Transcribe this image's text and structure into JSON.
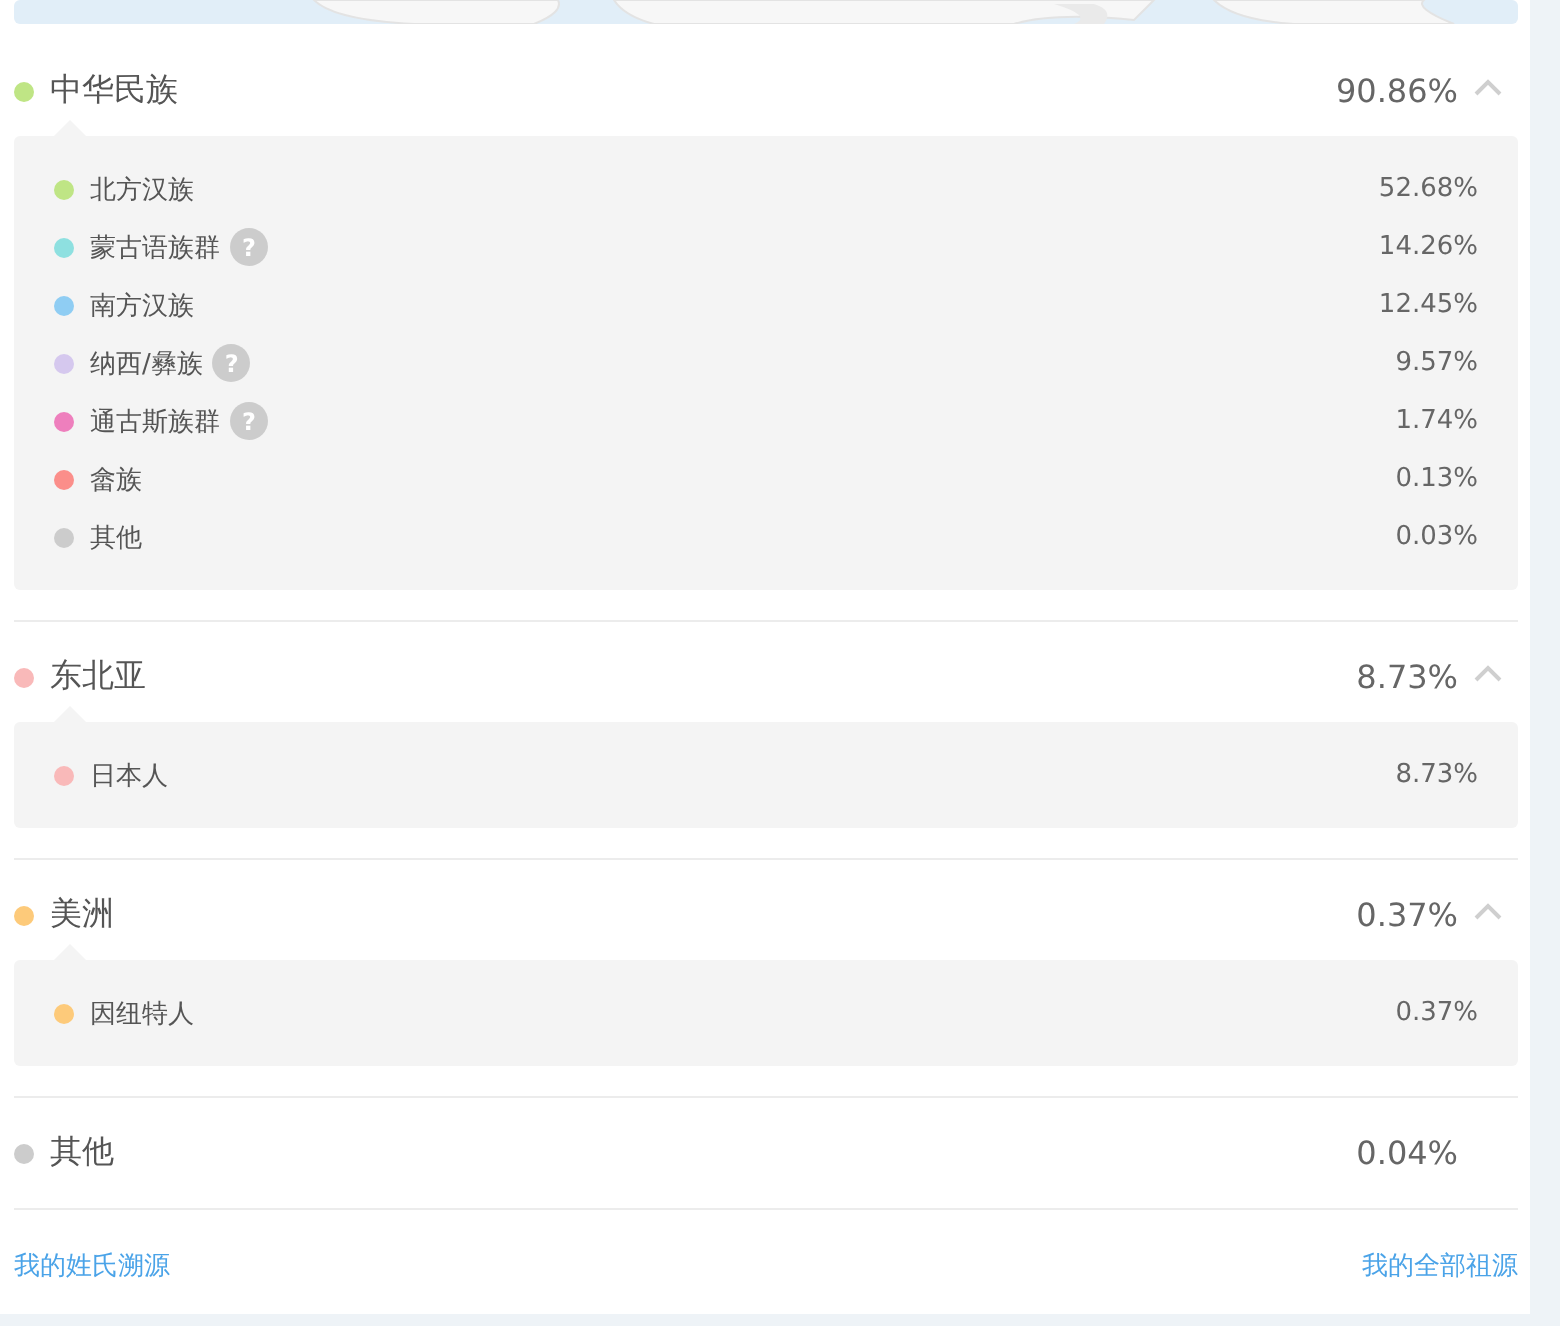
{
  "groups": [
    {
      "name": "中华民族",
      "percent": "90.86%",
      "color": "#bfe585",
      "expanded": true,
      "items": [
        {
          "name": "北方汉族",
          "percent": "52.68%",
          "color": "#bfe585"
        },
        {
          "name": "蒙古语族群",
          "percent": "14.26%",
          "color": "#8ee0e0",
          "help": "?"
        },
        {
          "name": "南方汉族",
          "percent": "12.45%",
          "color": "#8fcdf3"
        },
        {
          "name": "纳西/彝族",
          "percent": "9.57%",
          "color": "#d5c8ee",
          "help": "?"
        },
        {
          "name": "通古斯族群",
          "percent": "1.74%",
          "color": "#ee7fbd",
          "help": "?"
        },
        {
          "name": "畲族",
          "percent": "0.13%",
          "color": "#fb8e8a"
        },
        {
          "name": "其他",
          "percent": "0.03%",
          "color": "#cccccc"
        }
      ]
    },
    {
      "name": "东北亚",
      "percent": "8.73%",
      "color": "#f9b9b9",
      "expanded": true,
      "items": [
        {
          "name": "日本人",
          "percent": "8.73%",
          "color": "#f9b9b9"
        }
      ]
    },
    {
      "name": "美洲",
      "percent": "0.37%",
      "color": "#fdca7a",
      "expanded": true,
      "items": [
        {
          "name": "因纽特人",
          "percent": "0.37%",
          "color": "#fdca7a"
        }
      ]
    },
    {
      "name": "其他",
      "percent": "0.04%",
      "color": "#cccccc"
    }
  ],
  "links": [
    "我的姓氏溯源",
    "我的全部祖源"
  ]
}
